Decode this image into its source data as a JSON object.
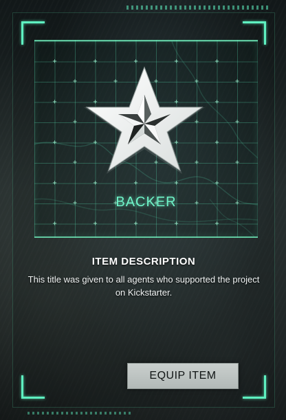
{
  "item": {
    "name": "BACKER",
    "icon": "star-badge-icon"
  },
  "description": {
    "heading": "ITEM DESCRIPTION",
    "text": "This title was given to all agents who supported the project on Kickstarter."
  },
  "actions": {
    "equip_label": "EQUIP ITEM"
  },
  "colors": {
    "accent": "#5ef0c0",
    "label": "#6ff4c8",
    "button_bg": "#c2c8c6",
    "button_text": "#101414"
  }
}
